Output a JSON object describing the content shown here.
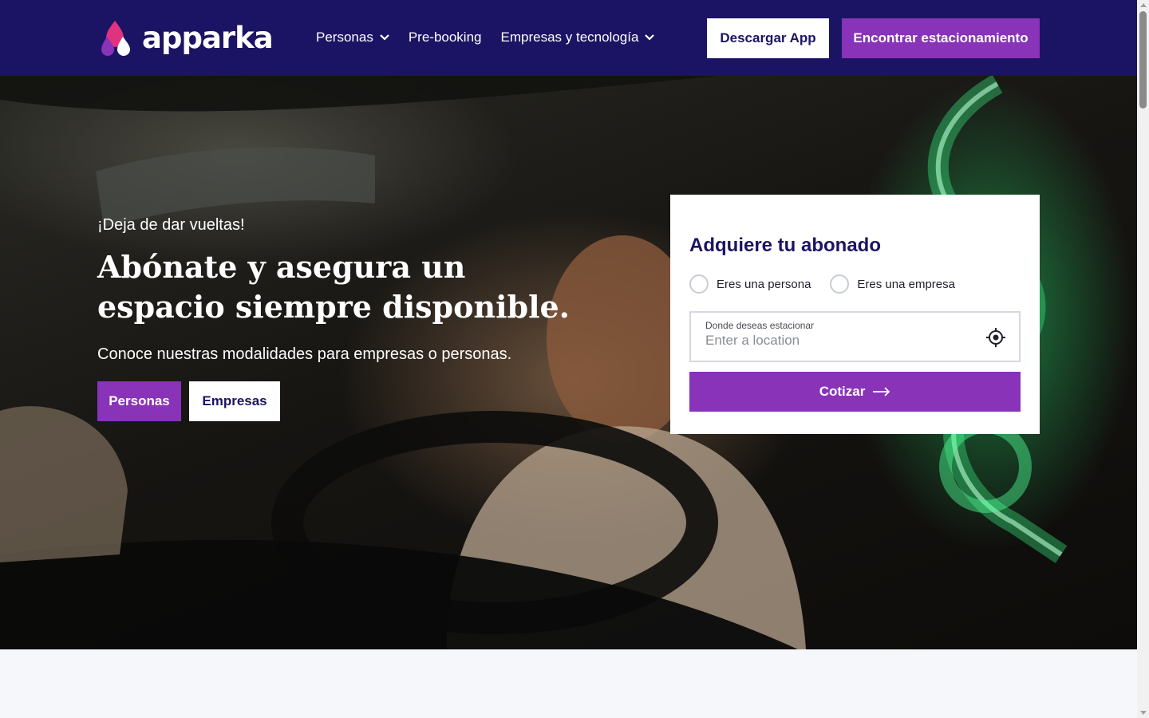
{
  "brand": {
    "name": "apparka",
    "colors": {
      "navy": "#1b1464",
      "purple": "#8833b8",
      "pink": "#e0337e"
    }
  },
  "nav": {
    "items": [
      {
        "label": "Personas",
        "has_dropdown": true
      },
      {
        "label": "Pre-booking",
        "has_dropdown": false
      },
      {
        "label": "Empresas y tecnología",
        "has_dropdown": true
      }
    ],
    "download_app": "Descargar App",
    "find_parking": "Encontrar estacionamiento"
  },
  "hero": {
    "eyebrow": "¡Deja de dar vueltas!",
    "headline": "Abónate y asegura un espacio siempre disponible.",
    "subtitle": "Conoce nuestras modalidades para empresas o personas.",
    "btn_personas": "Personas",
    "btn_empresas": "Empresas"
  },
  "quote_card": {
    "title": "Adquiere tu abonado",
    "options": [
      "Eres una persona",
      "Eres una empresa"
    ],
    "location_label": "Donde deseas estacionar",
    "location_placeholder": "Enter a location",
    "submit": "Cotizar",
    "icons": {
      "gps": "crosshair-icon",
      "arrow": "arrow-right-icon"
    }
  }
}
